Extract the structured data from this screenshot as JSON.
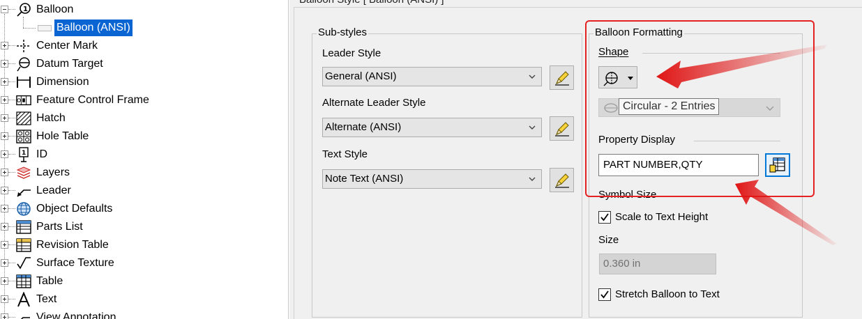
{
  "tree": {
    "items": [
      {
        "label": "Balloon",
        "icon": "balloon-icon"
      },
      {
        "label": "Balloon (ANSI)",
        "icon": "style-icon",
        "selected": true
      },
      {
        "label": "Center Mark",
        "icon": "center-mark-icon"
      },
      {
        "label": "Datum Target",
        "icon": "datum-target-icon"
      },
      {
        "label": "Dimension",
        "icon": "dimension-icon"
      },
      {
        "label": "Feature Control Frame",
        "icon": "feature-control-frame-icon"
      },
      {
        "label": "Hatch",
        "icon": "hatch-icon"
      },
      {
        "label": "Hole Table",
        "icon": "hole-table-icon"
      },
      {
        "label": "ID",
        "icon": "id-icon"
      },
      {
        "label": "Layers",
        "icon": "layers-icon"
      },
      {
        "label": "Leader",
        "icon": "leader-icon"
      },
      {
        "label": "Object Defaults",
        "icon": "object-defaults-icon"
      },
      {
        "label": "Parts List",
        "icon": "parts-list-icon"
      },
      {
        "label": "Revision Table",
        "icon": "revision-table-icon"
      },
      {
        "label": "Surface Texture",
        "icon": "surface-texture-icon"
      },
      {
        "label": "Table",
        "icon": "table-icon"
      },
      {
        "label": "Text",
        "icon": "text-icon"
      },
      {
        "label": "View Annotation",
        "icon": "view-annotation-icon"
      }
    ]
  },
  "panel": {
    "header": "Balloon Style [ Balloon (ANSI) ]",
    "substyles": {
      "title": "Sub-styles",
      "leader_style_label": "Leader Style",
      "leader_style_value": "General (ANSI)",
      "alt_leader_style_label": "Alternate Leader Style",
      "alt_leader_style_value": "Alternate (ANSI)",
      "text_style_label": "Text Style",
      "text_style_value": "Note Text (ANSI)"
    },
    "formatting": {
      "title": "Balloon Formatting",
      "shape_label": "Shape",
      "shape_tooltip": "Circular - 2 Entries",
      "property_display_label": "Property Display",
      "property_display_value": "PART NUMBER,QTY",
      "symbol_size_label": "Symbol Size",
      "scale_to_text_label": "Scale to Text Height",
      "scale_to_text_checked": true,
      "size_label": "Size",
      "size_value": "0.360 in",
      "stretch_label": "Stretch Balloon to Text",
      "stretch_checked": true
    }
  },
  "colors": {
    "selection": "#0a64d2",
    "highlight": "#e52222",
    "focus": "#0078d7"
  }
}
